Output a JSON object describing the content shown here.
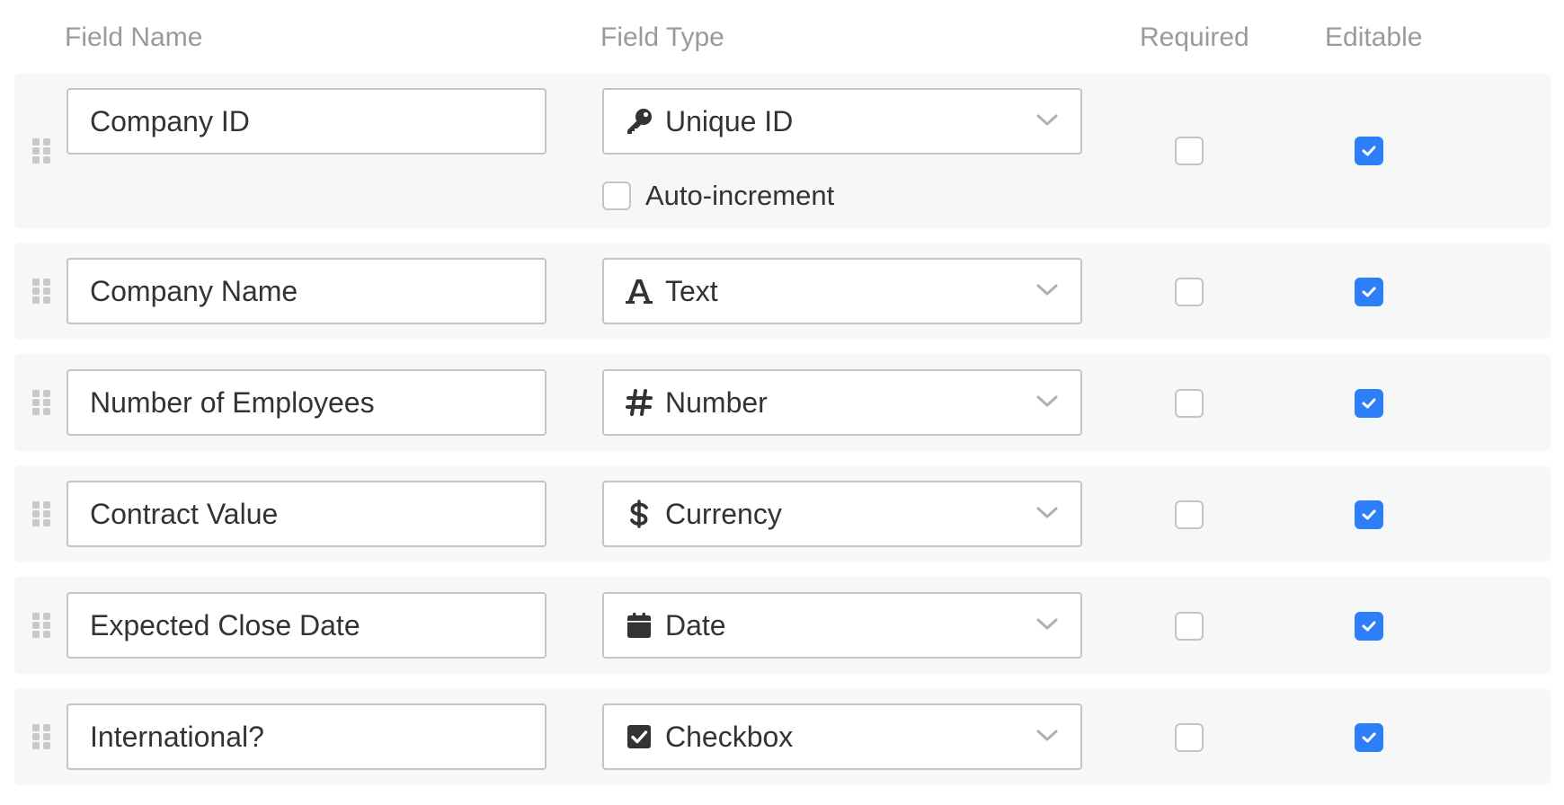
{
  "headers": {
    "field_name": "Field Name",
    "field_type": "Field Type",
    "required": "Required",
    "editable": "Editable"
  },
  "accent_color": "#2d7ff9",
  "rows": [
    {
      "field_name": "Company ID",
      "field_type": "Unique ID",
      "type_icon": "key-icon",
      "required": false,
      "editable": true,
      "option": {
        "label": "Auto-increment",
        "checked": false
      }
    },
    {
      "field_name": "Company Name",
      "field_type": "Text",
      "type_icon": "text-a-icon",
      "required": false,
      "editable": true
    },
    {
      "field_name": "Number of Employees",
      "field_type": "Number",
      "type_icon": "hash-icon",
      "required": false,
      "editable": true
    },
    {
      "field_name": "Contract Value",
      "field_type": "Currency",
      "type_icon": "dollar-icon",
      "required": false,
      "editable": true
    },
    {
      "field_name": "Expected Close Date",
      "field_type": "Date",
      "type_icon": "calendar-icon",
      "required": false,
      "editable": true
    },
    {
      "field_name": "International?",
      "field_type": "Checkbox",
      "type_icon": "checkbox-icon",
      "required": false,
      "editable": true
    }
  ]
}
